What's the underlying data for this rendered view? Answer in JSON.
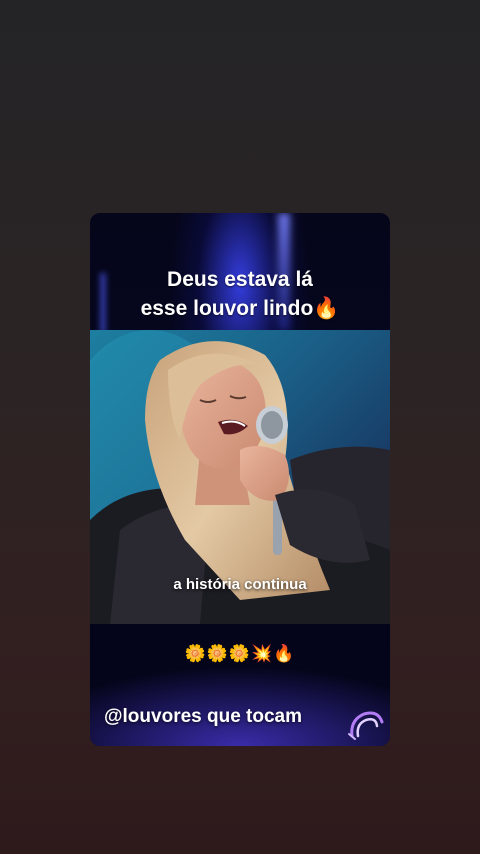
{
  "story": {
    "caption_line1": "Deus estava lá",
    "caption_line2": "esse louvor lindo🔥",
    "video_subtitle": "a história continua",
    "emoji_row": "🌼🌼🌼💥🔥",
    "handle": "@louvores que tocam"
  },
  "icons": {
    "magnet": "magnet-sticker-icon"
  },
  "colors": {
    "page_top": "#242426",
    "page_bottom": "#2e1a1b",
    "card_bg": "#05061a",
    "stage_light": "#3c46ff",
    "text": "#ffffff"
  }
}
